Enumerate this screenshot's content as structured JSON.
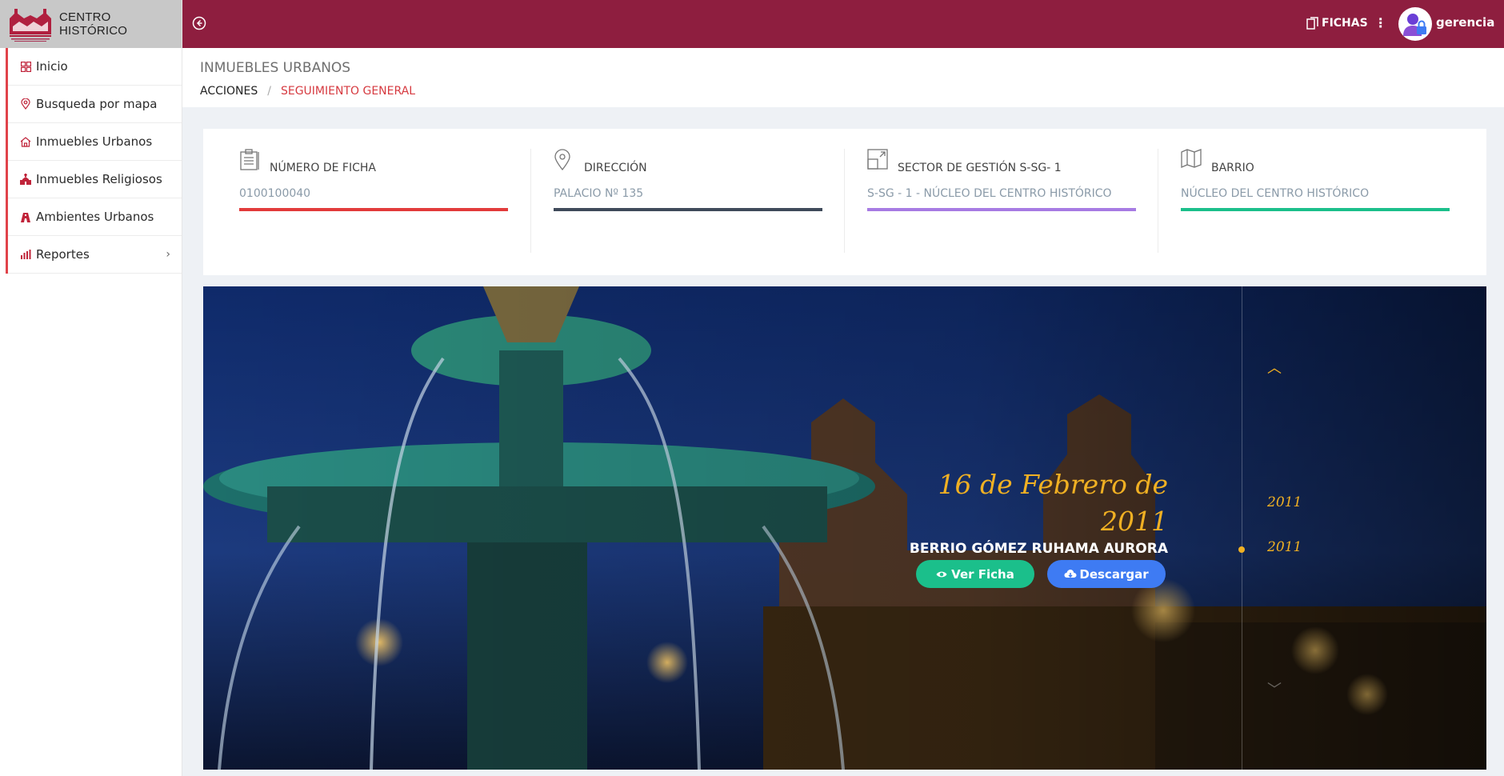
{
  "brand": {
    "name": "CENTRO HISTÓRICO",
    "logo_icon": "cusco-cathedral-logo"
  },
  "sidebar": {
    "items": [
      {
        "label": "Inicio",
        "icon": "grid-icon"
      },
      {
        "label": "Busqueda por mapa",
        "icon": "map-pin-icon"
      },
      {
        "label": "Inmuebles Urbanos",
        "icon": "home-icon"
      },
      {
        "label": "Inmuebles Religiosos",
        "icon": "church-icon"
      },
      {
        "label": "Ambientes Urbanos",
        "icon": "building-icon"
      },
      {
        "label": "Reportes",
        "icon": "bar-chart-icon"
      }
    ]
  },
  "topbar": {
    "fichas_label": "FICHAS",
    "username": "gerencia",
    "color": "#8e1e3f"
  },
  "page": {
    "title": "INMUEBLES URBANOS",
    "breadcrumb": [
      "ACCIONES",
      "SEGUIMIENTO GENERAL"
    ]
  },
  "info": [
    {
      "label": "NÚMERO DE FICHA",
      "value": "0100100040",
      "color": "#e23b3b",
      "icon": "clipboard-icon"
    },
    {
      "label": "DIRECCIÓN",
      "value": "PALACIO Nº 135",
      "color": "#3f4a5a",
      "icon": "map-pin-icon"
    },
    {
      "label": "SECTOR DE GESTIÓN S-SG- 1",
      "value": "S-SG - 1 - NÚCLEO DEL CENTRO HISTÓRICO",
      "color": "#a77be3",
      "icon": "resize-icon"
    },
    {
      "label": "BARRIO",
      "value": "NÚCLEO DEL CENTRO HISTÓRICO",
      "color": "#1bbf8b",
      "icon": "map-icon"
    }
  ],
  "hero": {
    "date_line1": "16 de Febrero de",
    "date_line2": "2011",
    "name": "BERRIO GÓMEZ RUHAMA AURORA",
    "ver_label": "Ver Ficha",
    "descargar_label": "Descargar",
    "timeline": [
      "2011",
      "2011"
    ]
  }
}
